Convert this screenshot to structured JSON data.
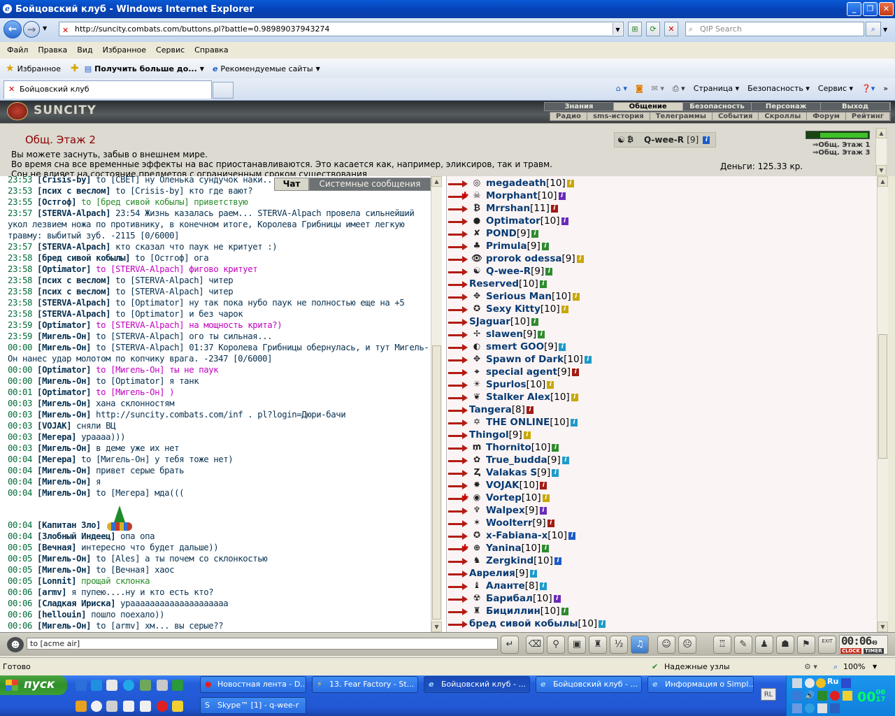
{
  "window": {
    "title": "Бойцовский клуб - Windows Internet Explorer"
  },
  "browser": {
    "address": "http://suncity.combats.com/buttons.pl?battle=0.98989037943274",
    "search_placeholder": "QIP Search",
    "menu": [
      "Файл",
      "Правка",
      "Вид",
      "Избранное",
      "Сервис",
      "Справка"
    ],
    "favorites_label": "Избранное",
    "fav_item1": "Получить больше до...",
    "fav_item2": "Рекомендуемые сайты",
    "tab_title": "Бойцовский клуб",
    "tools": [
      "Страница",
      "Безопасность",
      "Сервис"
    ]
  },
  "game": {
    "logo": "SUNCITY",
    "topnav": [
      "Знания",
      "Общение",
      "Безопасность",
      "Персонаж",
      "Выход"
    ],
    "topnav_active": "Общение",
    "subnav": [
      "Радио",
      "sms-история",
      "Телеграммы",
      "События",
      "Скроллы",
      "Форум",
      "Рейтинг"
    ],
    "room_title": "Общ. Этаж 2",
    "description": [
      "Вы можете заснуть, забыв о внешнем мире.",
      "Во время сна все временные эффекты на вас приостанавливаются. Это касается как, например, эликсиров, так и травм.",
      "Сон не влияет на состояние предметов с ограниченным сроком существования"
    ],
    "self_name": "Q-wee-R",
    "self_level": "[9]",
    "money": "Деньги: 125.33 кр.",
    "exits": [
      "Общ. Этаж 1",
      "Общ. Этаж 3"
    ],
    "chat_tabs": [
      "Чат",
      "Системные сообщения"
    ],
    "input_value": "to [acme air]",
    "clock_time": "00:06",
    "clock_sec": "49",
    "clock_label": "CLOCK",
    "timer_label": "TIMER",
    "exit_label": "EXIT"
  },
  "chat_messages": [
    {
      "time": "23:53",
      "nick": "Crisis-by",
      "text": "to [СВЕТ] ну Оленька сундучок наки..",
      "style": ""
    },
    {
      "time": "23:53",
      "nick": "псих с веслом",
      "text": "to [Crisis-by] кто где вают?",
      "style": ""
    },
    {
      "time": "23:55",
      "nick": "Остгоф",
      "text": "to [бред сивой кобылы] приветствую",
      "style": "green"
    },
    {
      "time": "23:57",
      "nick": "STERVA-Alpach",
      "text": "23:54 Жизнь казалась раем... STERVA-Alpach провела сильнейший укол лезвием ножа по противнику, в конечном итоге, Королева Грибницы имеет легкую травму: выбитый зуб. -2115 [0/6000]",
      "style": ""
    },
    {
      "time": "23:57",
      "nick": "STERVA-Alpach",
      "text": "кто сказал что паук не критует :)",
      "style": ""
    },
    {
      "time": "23:58",
      "nick": "бред сивой кобылы",
      "text": "to [Остгоф] ога",
      "style": ""
    },
    {
      "time": "23:58",
      "nick": "Optimator",
      "text": "to [STERVA-Alpach] фигово критует",
      "style": "pink"
    },
    {
      "time": "23:58",
      "nick": "псих с веслом",
      "text": "to [STERVA-Alpach] читер",
      "style": ""
    },
    {
      "time": "23:58",
      "nick": "псих с веслом",
      "text": "to [STERVA-Alpach] читер",
      "style": ""
    },
    {
      "time": "23:58",
      "nick": "STERVA-Alpach",
      "text": "to [Optimator] ну так пока нубо паук не полностью еще на +5",
      "style": ""
    },
    {
      "time": "23:58",
      "nick": "STERVA-Alpach",
      "text": "to [Optimator] и без чарок",
      "style": ""
    },
    {
      "time": "23:59",
      "nick": "Optimator",
      "text": "to [STERVA-Alpach] на мощность крита?)",
      "style": "pink"
    },
    {
      "time": "23:59",
      "nick": "Мигель-Он",
      "text": "to [STERVA-Alpach] ого ты сильная...",
      "style": ""
    },
    {
      "time": "00:00",
      "nick": "Мигель-Он",
      "text": "to [STERVA-Alpach] 01:37 Королева Грибницы обернулась, и тут Мигель-Он нанес удар молотом по копчику врага. -2347 [0/6000]",
      "style": ""
    },
    {
      "time": "00:00",
      "nick": "Optimator",
      "text": "to [Мигель-Он] ты не паук",
      "style": "pink"
    },
    {
      "time": "00:00",
      "nick": "Мигель-Он",
      "text": "to [Optimator] я танк",
      "style": ""
    },
    {
      "time": "00:01",
      "nick": "Optimator",
      "text": "to [Мигель-Он] )",
      "style": "pink"
    },
    {
      "time": "00:03",
      "nick": "Мигель-Он",
      "text": "хана склонностям",
      "style": ""
    },
    {
      "time": "00:03",
      "nick": "Мигель-Он",
      "text": "http://suncity.combats.com/inf . pl?login=Дюри-бачи",
      "style": ""
    },
    {
      "time": "00:03",
      "nick": "VOJAK",
      "text": "сняли ВЦ",
      "style": ""
    },
    {
      "time": "00:03",
      "nick": "Мегера",
      "text": "ураааа)))",
      "style": ""
    },
    {
      "time": "00:03",
      "nick": "Мигель-Он",
      "text": "в деме уже их нет",
      "style": ""
    },
    {
      "time": "00:04",
      "nick": "Мегера",
      "text": "to [Мигель-Он] у тебя тоже нет)",
      "style": ""
    },
    {
      "time": "00:04",
      "nick": "Мигель-Он",
      "text": "привет серые брать",
      "style": ""
    },
    {
      "time": "00:04",
      "nick": "Мигель-Он",
      "text": "я",
      "style": ""
    },
    {
      "time": "00:04",
      "nick": "Мигель-Он",
      "text": "to [Мегера] мда(((",
      "style": ""
    },
    {
      "time": "00:04",
      "nick": "Капитан Зло",
      "text": "",
      "style": "tree"
    },
    {
      "time": "00:04",
      "nick": "Злобный Индеец",
      "text": "опа опа",
      "style": ""
    },
    {
      "time": "00:05",
      "nick": "Вечная",
      "text": "интересно что будет дальше))",
      "style": ""
    },
    {
      "time": "00:05",
      "nick": "Мигель-Он",
      "text": "to [Ales] а ты почем со склонкостью",
      "style": ""
    },
    {
      "time": "00:05",
      "nick": "Мигель-Он",
      "text": "to [Вечная] хаос",
      "style": ""
    },
    {
      "time": "00:05",
      "nick": "Lonnit",
      "text": "прощай склонка",
      "style": "green"
    },
    {
      "time": "00:06",
      "nick": "armv",
      "text": "я пупею....ну и кто есть кто?",
      "style": ""
    },
    {
      "time": "00:06",
      "nick": "Сладкая Ириска",
      "text": "ураааааааааааааааааааа",
      "style": ""
    },
    {
      "time": "00:06",
      "nick": "hellouin",
      "text": "пошло поехало))",
      "style": ""
    },
    {
      "time": "00:06",
      "nick": "Мигель-Он",
      "text": "to [armv] хм... вы серые??",
      "style": ""
    }
  ],
  "users": [
    {
      "name": "megadeath",
      "level": "[10]",
      "icon": "◎",
      "info": "#c9a800",
      "red": false
    },
    {
      "name": "Morphant",
      "level": "[10]",
      "icon": "☠",
      "info": "#6a2bb8",
      "red": true
    },
    {
      "name": "Mrrshan",
      "level": "[11]",
      "icon": "₿",
      "info": "#a11b14",
      "red": false
    },
    {
      "name": "Optimator",
      "level": "[10]",
      "icon": "●",
      "info": "#6a2bb8",
      "red": false
    },
    {
      "name": "POND",
      "level": "[9]",
      "icon": "✘",
      "info": "#2e8b2e",
      "red": false
    },
    {
      "name": "Primula",
      "level": "[9]",
      "icon": "♣",
      "info": "#2e8b2e",
      "red": false
    },
    {
      "name": "prorok odessa",
      "level": "[9]",
      "icon": "👁",
      "info": "#c9a800",
      "red": false
    },
    {
      "name": "Q-wee-R",
      "level": "[9]",
      "icon": "☯",
      "info": "#2e8b2e",
      "red": false
    },
    {
      "name": "Reserved",
      "level": "[10]",
      "icon": "",
      "info": "#2e8b2e",
      "red": false
    },
    {
      "name": "Serious Man",
      "level": "[10]",
      "icon": "✥",
      "info": "#c9a800",
      "red": false
    },
    {
      "name": "Sexy Kitty",
      "level": "[10]",
      "icon": "✪",
      "info": "#c9a800",
      "red": false
    },
    {
      "name": "SJaguar",
      "level": "[10]",
      "icon": "",
      "info": "#2e8b2e",
      "red": false
    },
    {
      "name": "slawen",
      "level": "[9]",
      "icon": "✢",
      "info": "#2e8b2e",
      "red": false
    },
    {
      "name": "smert GOO",
      "level": "[9]",
      "icon": "◐",
      "info": "#1e9bc8",
      "red": false
    },
    {
      "name": "Spawn of Dark",
      "level": "[10]",
      "icon": "✥",
      "info": "#1e9bc8",
      "red": false
    },
    {
      "name": "special agent",
      "level": "[9]",
      "icon": "⌖",
      "info": "#a11b14",
      "red": false
    },
    {
      "name": "Spurlos",
      "level": "[10]",
      "icon": "☀",
      "info": "#c9a800",
      "red": false
    },
    {
      "name": "Stalker Alex",
      "level": "[10]",
      "icon": "❦",
      "info": "#c9a800",
      "red": false
    },
    {
      "name": "Tangera",
      "level": "[8]",
      "icon": "",
      "info": "#a11b14",
      "red": false
    },
    {
      "name": "THE ONLINE",
      "level": "[10]",
      "icon": "✡",
      "info": "#1e9bc8",
      "red": false
    },
    {
      "name": "Thingol",
      "level": "[9]",
      "icon": "",
      "info": "#c9a800",
      "red": false
    },
    {
      "name": "Thornito",
      "level": "[10]",
      "icon": "₥",
      "info": "#2e8b2e",
      "red": false
    },
    {
      "name": "True_budda",
      "level": "[9]",
      "icon": "✿",
      "info": "#1e9bc8",
      "red": false
    },
    {
      "name": "Valakas S",
      "level": "[9]",
      "icon": "Ⱬ",
      "info": "#1e9bc8",
      "red": false
    },
    {
      "name": "VOJAK",
      "level": "[10]",
      "icon": "✸",
      "info": "#a11b14",
      "red": false
    },
    {
      "name": "Vortep",
      "level": "[10]",
      "icon": "◉",
      "info": "#c9a800",
      "red": true
    },
    {
      "name": "Walpex",
      "level": "[9]",
      "icon": "♆",
      "info": "#6a2bb8",
      "red": false
    },
    {
      "name": "Woolterr",
      "level": "[9]",
      "icon": "✶",
      "info": "#a11b14",
      "red": false
    },
    {
      "name": "x-Fabiana-x",
      "level": "[10]",
      "icon": "✪",
      "info": "#1e5bc8",
      "red": false
    },
    {
      "name": "Yanina",
      "level": "[10]",
      "icon": "⊕",
      "info": "#2e8b2e",
      "red": true
    },
    {
      "name": "Zergkind",
      "level": "[10]",
      "icon": "♞",
      "info": "#1e5bc8",
      "red": false
    },
    {
      "name": "Аврелия",
      "level": "[9]",
      "icon": "",
      "info": "#1e9bc8",
      "red": false
    },
    {
      "name": "Аланте",
      "level": "[8]",
      "icon": "♝",
      "info": "#1e9bc8",
      "red": false
    },
    {
      "name": "Барибал",
      "level": "[10]",
      "icon": "☢",
      "info": "#6a2bb8",
      "red": false
    },
    {
      "name": "Бициллин",
      "level": "[10]",
      "icon": "♜",
      "info": "#2e8b2e",
      "red": false
    },
    {
      "name": "бред сивой кобылы",
      "level": "[10]",
      "icon": "",
      "info": "#1e9bc8",
      "red": false
    }
  ],
  "status": {
    "left": "Готово",
    "zone": "Надежные узлы",
    "zoom": "100%"
  },
  "taskbar": {
    "start": "пуск",
    "buttons": [
      "Новостная лента - D...",
      "13. Fear Factory - St...",
      "Бойцовский клуб - ...",
      "Бойцовский клуб - ...",
      "Информация о Simpl..."
    ],
    "skype": "Skype™ [1] - q-wee-r",
    "lang": "Ru",
    "rl": "RL",
    "time": "00",
    "time_min": "06",
    "time_sec": "17"
  }
}
